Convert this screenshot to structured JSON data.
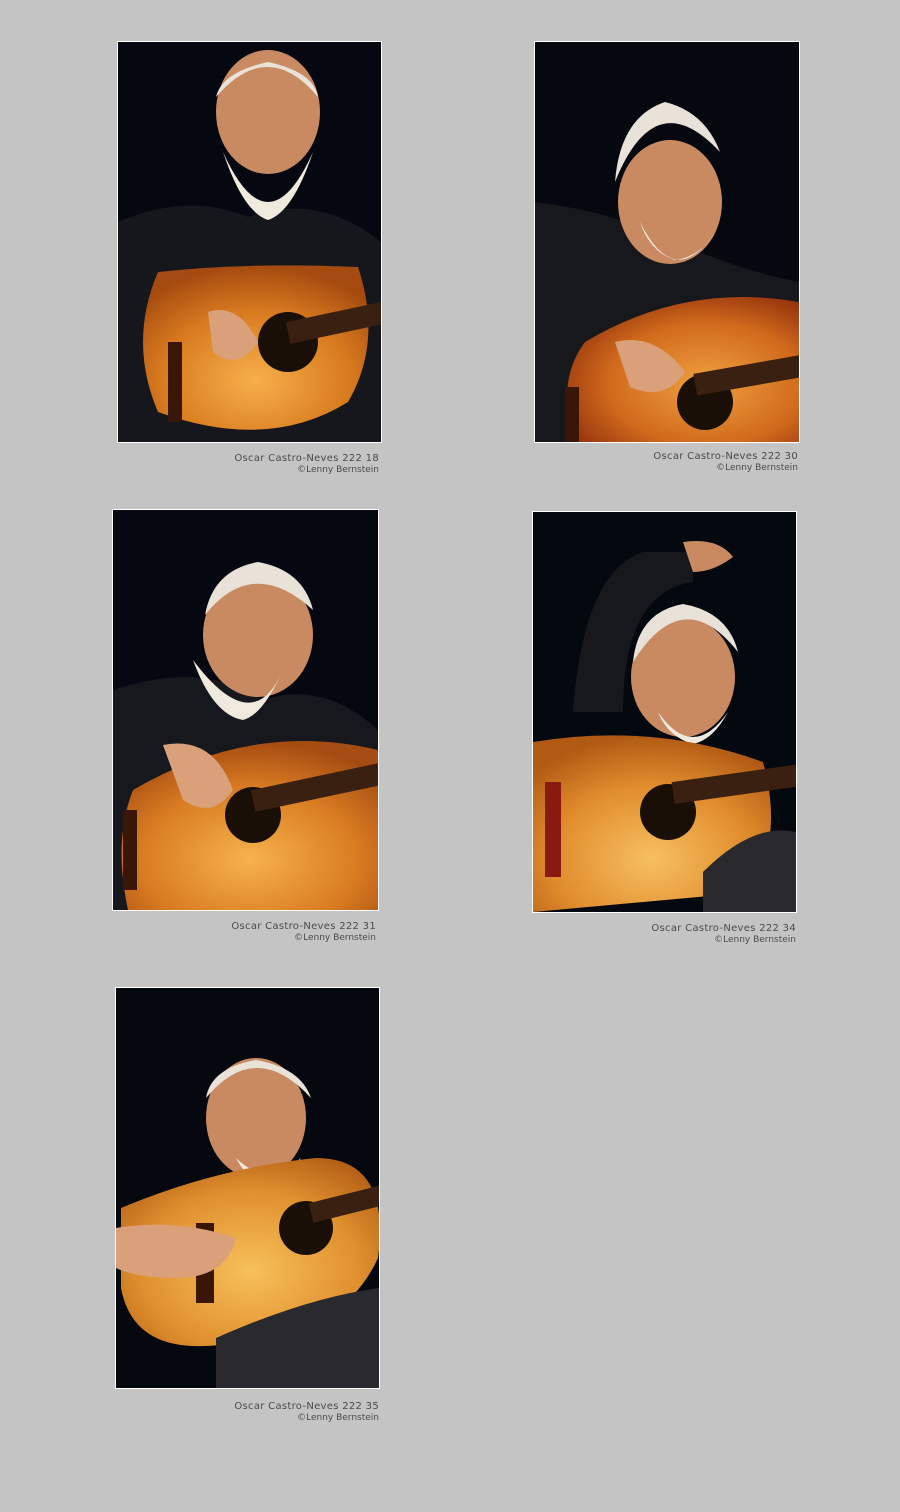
{
  "gallery": {
    "photos": [
      {
        "title": "Oscar Castro-Neves 222 18",
        "credit": "©Lenny Bernstein"
      },
      {
        "title": "Oscar Castro-Neves 222 30",
        "credit": "©Lenny Bernstein"
      },
      {
        "title": "Oscar Castro-Neves 222 31",
        "credit": "©Lenny Bernstein"
      },
      {
        "title": "Oscar Castro-Neves 222 34",
        "credit": "©Lenny Bernstein"
      },
      {
        "title": "Oscar Castro-Neves 222 35",
        "credit": "©Lenny Bernstein"
      }
    ]
  },
  "colors": {
    "page_background": "#c4c4c4",
    "photo_border": "#ffffff",
    "caption_text": "#4a4a4a",
    "stage_background": "#06090f",
    "guitar_wood": "#e8922a"
  }
}
